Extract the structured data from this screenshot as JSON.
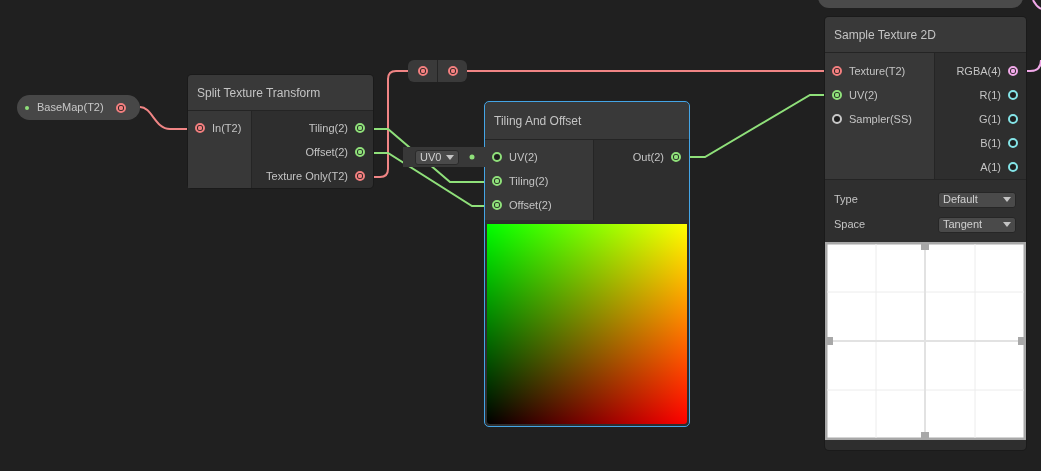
{
  "nodes": [
    {
      "kind": "property",
      "label": "BaseMap(T2)",
      "color": "#8fe07a",
      "port": {
        "color": "#f27f7f",
        "connected": true
      }
    },
    {
      "kind": "node",
      "title": "Split Texture Transform",
      "selected": false,
      "inputs": [
        {
          "label": "In(T2)",
          "color": "#f27f7f",
          "connected": true
        }
      ],
      "outputs": [
        {
          "label": "Tiling(2)",
          "color": "#8fe07a",
          "connected": true
        },
        {
          "label": "Offset(2)",
          "color": "#8fe07a",
          "connected": true
        },
        {
          "label": "Texture Only(T2)",
          "color": "#f27f7f",
          "connected": true
        }
      ]
    },
    {
      "kind": "redirect",
      "ports": [
        {
          "color": "#f27f7f",
          "connected": true
        },
        {
          "color": "#f27f7f",
          "connected": true
        }
      ]
    },
    {
      "kind": "node",
      "title": "Tiling And Offset",
      "selected": true,
      "inline_default": "UV0",
      "inputs": [
        {
          "label": "UV(2)",
          "color": "#8fe07a",
          "connected": false
        },
        {
          "label": "Tiling(2)",
          "color": "#8fe07a",
          "connected": true
        },
        {
          "label": "Offset(2)",
          "color": "#8fe07a",
          "connected": true
        }
      ],
      "outputs": [
        {
          "label": "Out(2)",
          "color": "#8fe07a",
          "connected": true
        }
      ],
      "preview": {
        "kind": "gradient"
      }
    },
    {
      "kind": "node",
      "title": "Sample Texture 2D",
      "selected": false,
      "inputs": [
        {
          "label": "Texture(T2)",
          "color": "#f27f7f",
          "connected": true
        },
        {
          "label": "UV(2)",
          "color": "#8fe07a",
          "connected": true
        },
        {
          "label": "Sampler(SS)",
          "color": "#c8c8c8",
          "connected": false
        }
      ],
      "outputs": [
        {
          "label": "RGBA(4)",
          "color": "#f0a8e8",
          "connected": true
        },
        {
          "label": "R(1)",
          "color": "#84e4e7",
          "connected": false
        },
        {
          "label": "G(1)",
          "color": "#84e4e7",
          "connected": false
        },
        {
          "label": "B(1)",
          "color": "#84e4e7",
          "connected": false
        },
        {
          "label": "A(1)",
          "color": "#84e4e7",
          "connected": false
        }
      ],
      "settings": [
        {
          "label": "Type",
          "value": "Default"
        },
        {
          "label": "Space",
          "value": "Tangent"
        }
      ],
      "preview": {
        "kind": "texture"
      }
    }
  ]
}
